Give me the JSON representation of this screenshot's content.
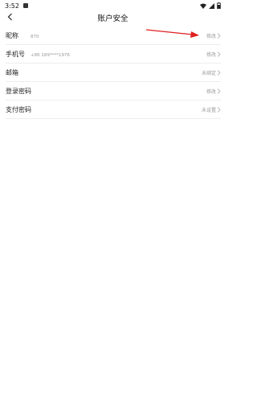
{
  "status_bar": {
    "time": "3:52"
  },
  "header": {
    "title": "账户安全"
  },
  "rows": [
    {
      "label": "昵称",
      "value": "870",
      "action": "修改"
    },
    {
      "label": "手机号",
      "value": "+86 189****1976",
      "action": "修改"
    },
    {
      "label": "邮箱",
      "value": "",
      "action": "未绑定"
    },
    {
      "label": "登录密码",
      "value": "",
      "action": "修改"
    },
    {
      "label": "支付密码",
      "value": "",
      "action": "未设置"
    }
  ],
  "icons": {
    "back": "chevron-left-icon",
    "row_chevron": "chevron-right-icon",
    "wifi": "wifi-icon",
    "signal": "signal-icon",
    "battery": "battery-icon"
  },
  "colors": {
    "annotation_arrow": "#e02020",
    "secondary_text": "#9a9a9a",
    "divider": "#ededed"
  }
}
